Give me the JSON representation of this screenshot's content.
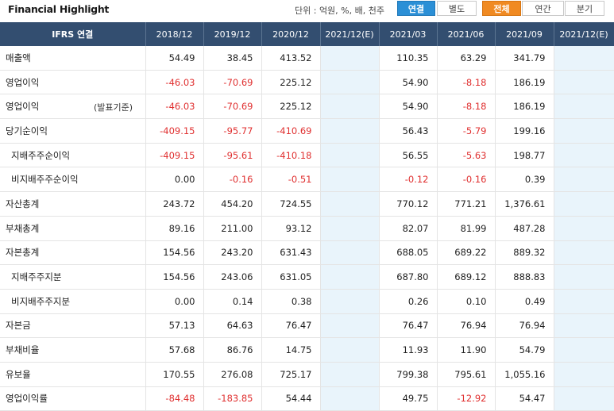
{
  "header": {
    "title": "Financial Highlight",
    "unit_text": "단위 : 억원, %, 배, 천주",
    "buttons": [
      "연결",
      "별도",
      "전체",
      "연간",
      "분기"
    ]
  },
  "table": {
    "columns": [
      "IFRS 연결",
      "2018/12",
      "2019/12",
      "2020/12",
      "2021/12(E)",
      "2021/03",
      "2021/06",
      "2021/09",
      "2021/12(E)"
    ],
    "rows": [
      {
        "label": "매출액",
        "sub": false,
        "note": "",
        "values": [
          "54.49",
          "38.45",
          "413.52",
          "",
          "110.35",
          "63.29",
          "341.79",
          ""
        ]
      },
      {
        "label": "영업이익",
        "sub": false,
        "note": "",
        "values": [
          "-46.03",
          "-70.69",
          "225.12",
          "",
          "54.90",
          "-8.18",
          "186.19",
          ""
        ]
      },
      {
        "label": "영업이익",
        "sub": false,
        "note": "(발표기준)",
        "values": [
          "-46.03",
          "-70.69",
          "225.12",
          "",
          "54.90",
          "-8.18",
          "186.19",
          ""
        ]
      },
      {
        "label": "당기순이익",
        "sub": false,
        "note": "",
        "values": [
          "-409.15",
          "-95.77",
          "-410.69",
          "",
          "56.43",
          "-5.79",
          "199.16",
          ""
        ]
      },
      {
        "label": "지배주주순이익",
        "sub": true,
        "note": "",
        "values": [
          "-409.15",
          "-95.61",
          "-410.18",
          "",
          "56.55",
          "-5.63",
          "198.77",
          ""
        ]
      },
      {
        "label": "비지배주주순이익",
        "sub": true,
        "note": "",
        "values": [
          "0.00",
          "-0.16",
          "-0.51",
          "",
          "-0.12",
          "-0.16",
          "0.39",
          ""
        ]
      },
      {
        "label": "자산총계",
        "sub": false,
        "note": "",
        "values": [
          "243.72",
          "454.20",
          "724.55",
          "",
          "770.12",
          "771.21",
          "1,376.61",
          ""
        ]
      },
      {
        "label": "부채총계",
        "sub": false,
        "note": "",
        "values": [
          "89.16",
          "211.00",
          "93.12",
          "",
          "82.07",
          "81.99",
          "487.28",
          ""
        ]
      },
      {
        "label": "자본총계",
        "sub": false,
        "note": "",
        "values": [
          "154.56",
          "243.20",
          "631.43",
          "",
          "688.05",
          "689.22",
          "889.32",
          ""
        ]
      },
      {
        "label": "지배주주지분",
        "sub": true,
        "note": "",
        "values": [
          "154.56",
          "243.06",
          "631.05",
          "",
          "687.80",
          "689.12",
          "888.83",
          ""
        ]
      },
      {
        "label": "비지배주주지분",
        "sub": true,
        "note": "",
        "values": [
          "0.00",
          "0.14",
          "0.38",
          "",
          "0.26",
          "0.10",
          "0.49",
          ""
        ]
      },
      {
        "label": "자본금",
        "sub": false,
        "note": "",
        "values": [
          "57.13",
          "64.63",
          "76.47",
          "",
          "76.47",
          "76.94",
          "76.94",
          ""
        ]
      },
      {
        "label": "부채비율",
        "sub": false,
        "note": "",
        "values": [
          "57.68",
          "86.76",
          "14.75",
          "",
          "11.93",
          "11.90",
          "54.79",
          ""
        ]
      },
      {
        "label": "유보율",
        "sub": false,
        "note": "",
        "values": [
          "170.55",
          "276.08",
          "725.17",
          "",
          "799.38",
          "795.61",
          "1,055.16",
          ""
        ]
      },
      {
        "label": "영업이익률",
        "sub": false,
        "note": "",
        "values": [
          "-84.48",
          "-183.85",
          "54.44",
          "",
          "49.75",
          "-12.92",
          "54.47",
          ""
        ]
      }
    ]
  },
  "colors": {
    "header_bg": "#334e70",
    "negative": "#e03030",
    "estimate_bg": "#e9f4fb",
    "accent_blue": "#2b8fd6",
    "accent_orange": "#f08a22"
  }
}
